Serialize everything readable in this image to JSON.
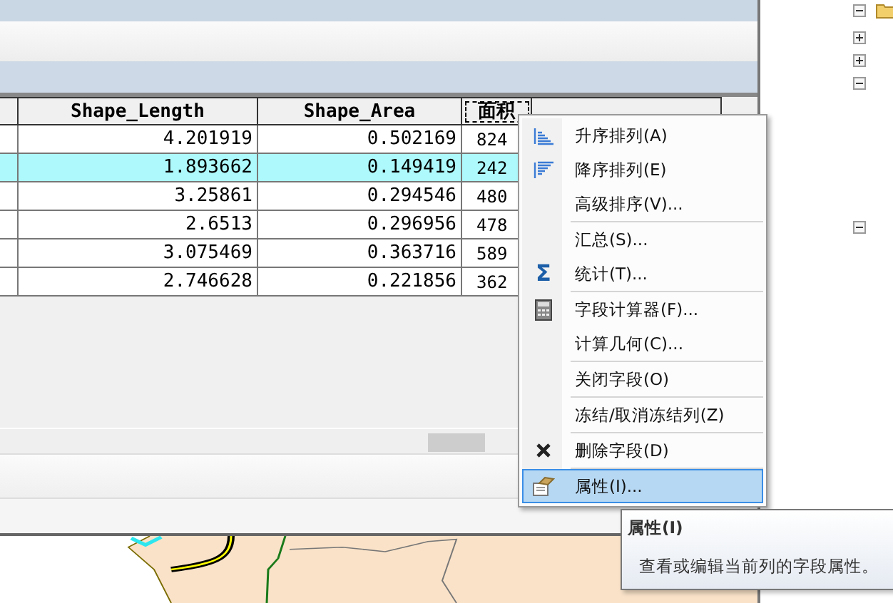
{
  "table": {
    "columns": [
      {
        "label": "Shape_Length",
        "selected": false
      },
      {
        "label": "Shape_Area",
        "selected": false
      },
      {
        "label": "面积",
        "selected": true
      }
    ],
    "rows": [
      {
        "selected": false,
        "cells": [
          "4.201919",
          "0.502169",
          "824"
        ]
      },
      {
        "selected": true,
        "cells": [
          "1.893662",
          "0.149419",
          "242"
        ]
      },
      {
        "selected": false,
        "cells": [
          "3.25861",
          "0.294546",
          "480"
        ]
      },
      {
        "selected": false,
        "cells": [
          "2.6513",
          "0.296956",
          "478"
        ]
      },
      {
        "selected": false,
        "cells": [
          "3.075469",
          "0.363716",
          "589"
        ]
      },
      {
        "selected": false,
        "cells": [
          "2.746628",
          "0.221856",
          "362"
        ]
      }
    ]
  },
  "context_menu": {
    "items": [
      {
        "label": "升序排列(A)",
        "divider_after": false,
        "selected": false
      },
      {
        "label": "降序排列(E)",
        "divider_after": false,
        "selected": false
      },
      {
        "label": "高级排序(V)...",
        "divider_after": true,
        "selected": false
      },
      {
        "label": "汇总(S)...",
        "divider_after": false,
        "selected": false
      },
      {
        "label": "统计(T)...",
        "symbol": "Σ",
        "divider_after": true,
        "selected": false
      },
      {
        "label": "字段计算器(F)...",
        "divider_after": false,
        "selected": false
      },
      {
        "label": "计算几何(C)...",
        "divider_after": true,
        "selected": false
      },
      {
        "label": "关闭字段(O)",
        "divider_after": true,
        "selected": false
      },
      {
        "label": "冻结/取消冻结列(Z)",
        "divider_after": true,
        "selected": false
      },
      {
        "label": "删除字段(D)",
        "divider_after": true,
        "selected": false
      },
      {
        "label": "属性(I)...",
        "divider_after": false,
        "selected": true
      }
    ]
  },
  "tooltip": {
    "title": "属性(I)",
    "text": "查看或编辑当前列的字段属性。"
  },
  "tree": {
    "nodes": [
      {
        "expanded": true
      },
      {
        "expanded": false
      },
      {
        "expanded": false
      },
      {
        "expanded": true
      },
      {
        "expanded": true
      }
    ]
  }
}
